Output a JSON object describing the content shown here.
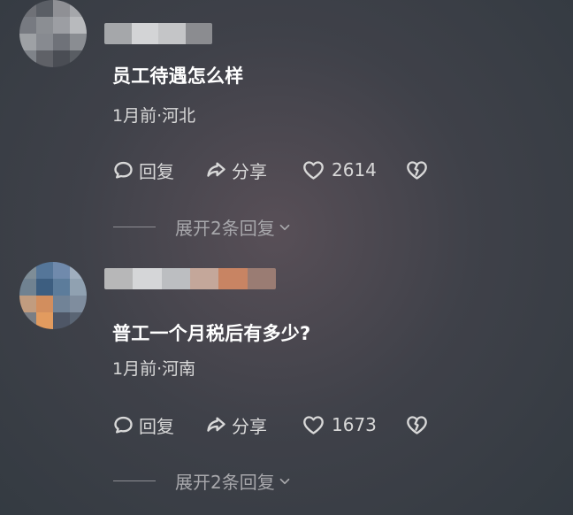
{
  "comments": [
    {
      "text": "员工待遇怎么样",
      "meta": "1月前·河北",
      "actions": {
        "reply_label": "回复",
        "share_label": "分享",
        "like_count": "2614",
        "dislike_icon": "broken-heart-icon"
      },
      "expand_label": "展开2条回复",
      "icons": {
        "reply": "comment-bubble-icon",
        "share": "share-arrow-icon",
        "like": "heart-icon",
        "dislike": "broken-heart-icon",
        "expand": "chevron-down-icon"
      }
    },
    {
      "text": "普工一个月税后有多少?",
      "meta": "1月前·河南",
      "actions": {
        "reply_label": "回复",
        "share_label": "分享",
        "like_count": "1673",
        "dislike_icon": "broken-heart-icon"
      },
      "expand_label": "展开2条回复",
      "icons": {
        "reply": "comment-bubble-icon",
        "share": "share-arrow-icon",
        "like": "heart-icon",
        "dislike": "broken-heart-icon",
        "expand": "chevron-down-icon"
      }
    }
  ],
  "colors": {
    "background": "#3d4048",
    "text_primary": "#ffffff",
    "text_secondary": "#d9d9d9",
    "text_muted": "#a7a7ab"
  }
}
